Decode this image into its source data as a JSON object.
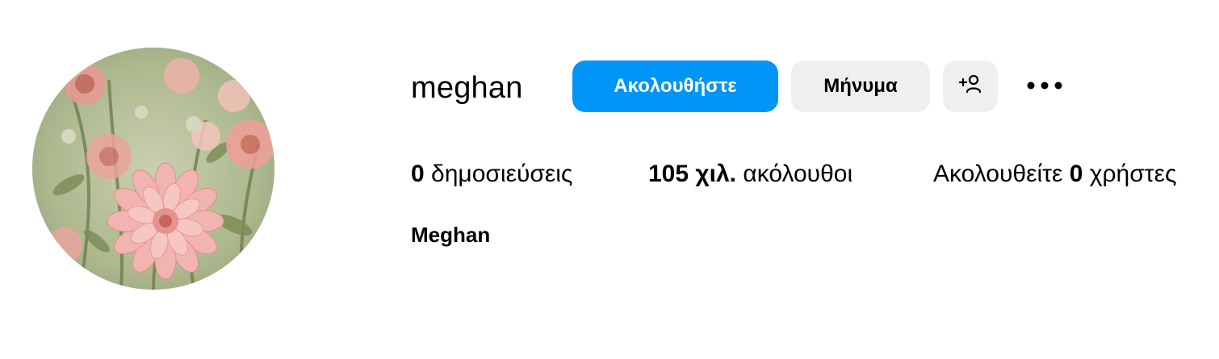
{
  "profile": {
    "username": "meghan",
    "full_name": "Meghan",
    "avatar_icon": "flower-photo-avatar"
  },
  "actions": {
    "follow_label": "Ακολουθήστε",
    "message_label": "Μήνυμα",
    "suggest_icon": "add-person-icon",
    "more_icon": "more-dots-icon"
  },
  "stats": {
    "posts_count": "0",
    "posts_label": "δημοσιεύσεις",
    "followers_count": "105 χιλ.",
    "followers_label": "ακόλουθοι",
    "following_prefix": "Ακολουθείτε",
    "following_count": "0",
    "following_suffix": "χρήστες"
  },
  "colors": {
    "accent": "#0095f6",
    "secondary_button": "#efefef",
    "text": "#000000"
  }
}
